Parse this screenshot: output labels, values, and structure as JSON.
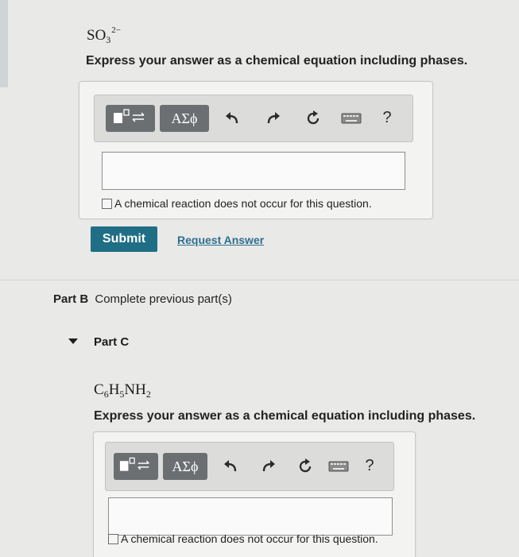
{
  "part_a": {
    "formula": {
      "base": "SO",
      "sub": "3",
      "sup": "2−"
    },
    "instruction": "Express your answer as a chemical equation including phases.",
    "toolbar": {
      "templates_icon": "templates-icon",
      "greek_label": "ΑΣϕ",
      "undo_icon": "undo-icon",
      "redo_icon": "redo-icon",
      "reset_icon": "reset-icon",
      "keyboard_icon": "keyboard-icon",
      "help_label": "?"
    },
    "answer_value": "",
    "no_reaction_label": "A chemical reaction does not occur for this question.",
    "submit_label": "Submit",
    "request_label": "Request Answer"
  },
  "part_b": {
    "label": "Part B",
    "status": "Complete previous part(s)"
  },
  "part_c": {
    "label": "Part C",
    "formula": {
      "a": "C",
      "a_sub": "6",
      "b": "H",
      "b_sub": "5",
      "c": "NH",
      "c_sub": "2"
    },
    "instruction": "Express your answer as a chemical equation including phases.",
    "toolbar": {
      "greek_label": "ΑΣϕ",
      "help_label": "?"
    },
    "answer_value": "",
    "no_reaction_label": "A chemical reaction does not occur for this question."
  }
}
